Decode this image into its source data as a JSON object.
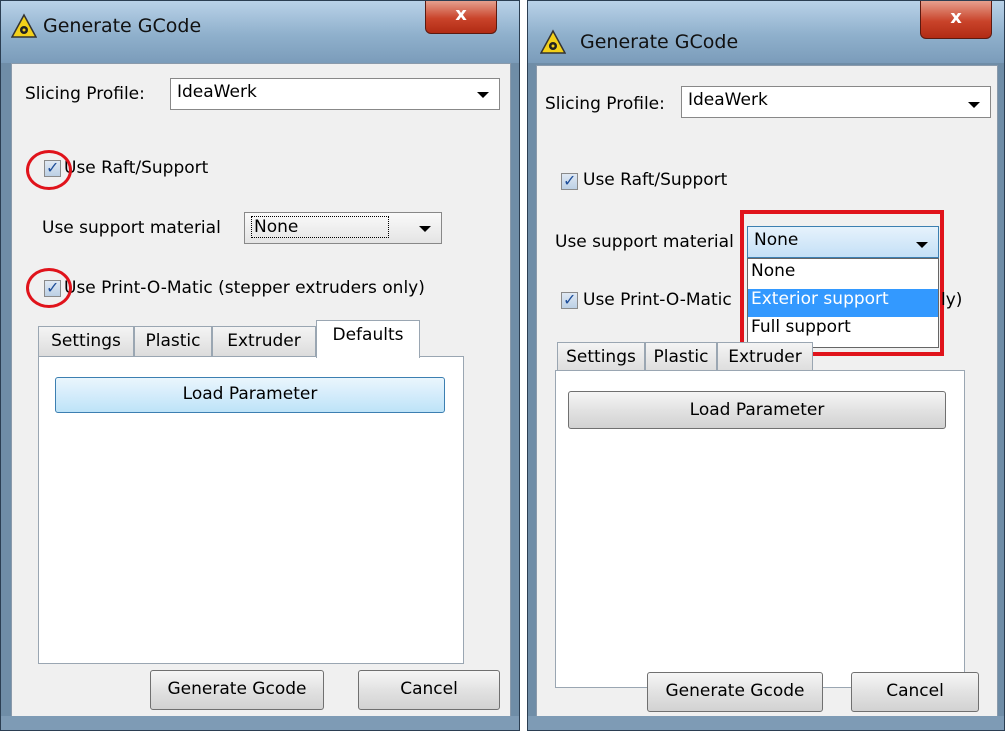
{
  "left_window": {
    "title": "Generate GCode",
    "close_label": "x",
    "slicing_profile": {
      "label": "Slicing Profile:",
      "value": "IdeaWerk"
    },
    "use_raft": {
      "label": "Use Raft/Support",
      "checked": true
    },
    "support_material": {
      "label": "Use support material",
      "value": "None"
    },
    "use_printomatic": {
      "label": "Use Print-O-Matic (stepper extruders only)",
      "checked": true
    },
    "tabs": [
      "Settings",
      "Plastic",
      "Extruder",
      "Defaults"
    ],
    "active_tab": "Defaults",
    "load_parameter": "Load Parameter",
    "generate": "Generate Gcode",
    "cancel": "Cancel"
  },
  "right_window": {
    "title": "Generate GCode",
    "close_label": "x",
    "slicing_profile": {
      "label": "Slicing Profile:",
      "value": "IdeaWerk"
    },
    "use_raft": {
      "label": "Use Raft/Support",
      "checked": true
    },
    "support_material": {
      "label": "Use support material",
      "value": "None"
    },
    "support_options": [
      "None",
      "Exterior support",
      "Full support"
    ],
    "highlighted_option": "Exterior support",
    "use_printomatic": {
      "label_start": "Use Print-O-Matic",
      "label_end": "ly)",
      "checked": true
    },
    "tabs": [
      "Settings",
      "Plastic",
      "Extruder"
    ],
    "load_parameter": "Load Parameter",
    "generate": "Generate Gcode",
    "cancel": "Cancel"
  },
  "colors": {
    "annotation_red": "#e0131b",
    "selection_blue": "#3399ff"
  }
}
